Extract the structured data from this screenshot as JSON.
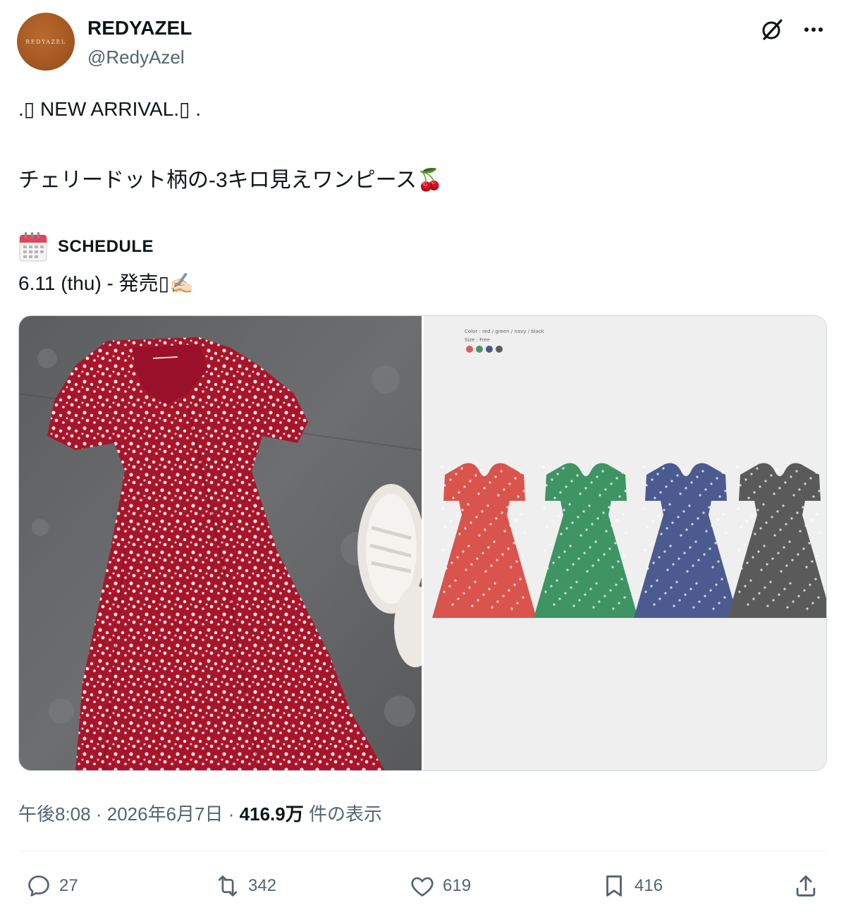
{
  "author": {
    "avatar_text": "REDYAZEL",
    "name": "REDYAZEL",
    "handle": "@RedyAzel"
  },
  "post": {
    "line1": ".▯ NEW ARRIVAL.▯ .",
    "line2": "チェリードット柄の-3キロ見えワンピース🍒",
    "schedule_label": "SCHEDULE",
    "line4": "6.11 (thu) - 発売▯✍🏻"
  },
  "media": {
    "right_info_line1": "Color : red / green / navy / black",
    "right_info_line2": "Size : Free",
    "swatch_colors": [
      "#d9605a",
      "#4f8f6a",
      "#4a5a86",
      "#5e5e5e"
    ],
    "dress_colors": [
      "#d9544d",
      "#3f9464",
      "#4c5b8f",
      "#5a5a5a"
    ]
  },
  "meta": {
    "time": "午後8:08",
    "date": "2026年6月7日",
    "views_count": "416.9万",
    "views_label": "件の表示",
    "separator": "·"
  },
  "actions": {
    "reply_count": "27",
    "repost_count": "342",
    "like_count": "619",
    "bookmark_count": "416"
  }
}
